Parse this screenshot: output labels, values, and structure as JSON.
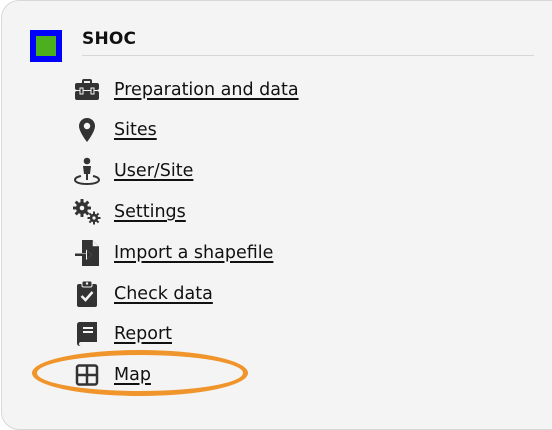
{
  "app": {
    "title": "SHOC"
  },
  "menu": {
    "items": [
      {
        "label": "Preparation and data",
        "icon": "toolbox-icon"
      },
      {
        "label": "Sites",
        "icon": "map-marker-icon"
      },
      {
        "label": "User/Site",
        "icon": "user-location-icon"
      },
      {
        "label": "Settings",
        "icon": "gears-icon"
      },
      {
        "label": "Import a shapefile",
        "icon": "file-import-icon"
      },
      {
        "label": "Check data",
        "icon": "clipboard-check-icon"
      },
      {
        "label": "Report",
        "icon": "book-icon"
      },
      {
        "label": "Map",
        "icon": "grid-icon"
      }
    ]
  },
  "colors": {
    "logo_border": "#0000ff",
    "logo_fill": "#4caf1e",
    "highlight": "#f0952b"
  }
}
